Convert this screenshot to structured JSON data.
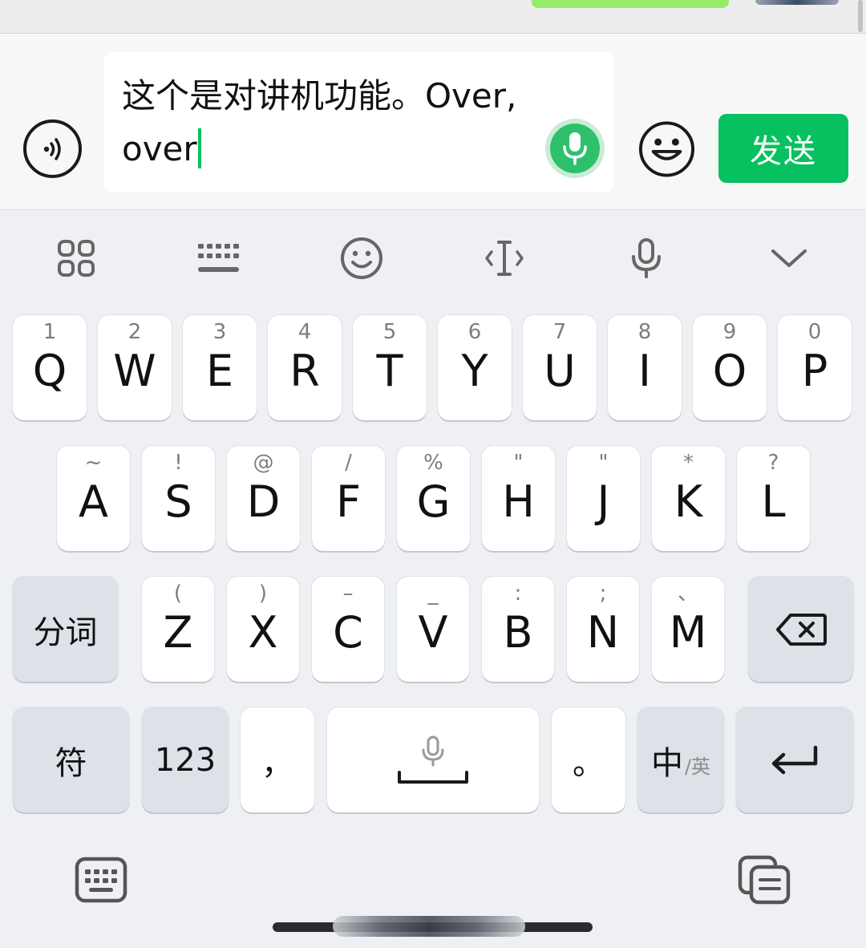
{
  "input": {
    "line1": "这个是对讲机功能。Over,",
    "line2": "over"
  },
  "send_label": "发送",
  "toolbar": {
    "icons": [
      "apps-grid-icon",
      "keyboard-icon",
      "emoji-icon",
      "cursor-icon",
      "microphone-icon",
      "chevron-down-icon"
    ]
  },
  "keyboard": {
    "row1": [
      {
        "hint": "1",
        "key": "Q"
      },
      {
        "hint": "2",
        "key": "W"
      },
      {
        "hint": "3",
        "key": "E"
      },
      {
        "hint": "4",
        "key": "R"
      },
      {
        "hint": "5",
        "key": "T"
      },
      {
        "hint": "6",
        "key": "Y"
      },
      {
        "hint": "7",
        "key": "U"
      },
      {
        "hint": "8",
        "key": "I"
      },
      {
        "hint": "9",
        "key": "O"
      },
      {
        "hint": "0",
        "key": "P"
      }
    ],
    "row2": [
      {
        "hint": "~",
        "key": "A"
      },
      {
        "hint": "!",
        "key": "S"
      },
      {
        "hint": "@",
        "key": "D"
      },
      {
        "hint": "/",
        "key": "F"
      },
      {
        "hint": "%",
        "key": "G"
      },
      {
        "hint": "\"",
        "key": "H"
      },
      {
        "hint": "\"",
        "key": "J"
      },
      {
        "hint": "*",
        "key": "K"
      },
      {
        "hint": "?",
        "key": "L"
      }
    ],
    "row3": [
      {
        "hint": "(",
        "key": "Z"
      },
      {
        "hint": ")",
        "key": "X"
      },
      {
        "hint": "–",
        "key": "C"
      },
      {
        "hint": "_",
        "key": "V"
      },
      {
        "hint": ":",
        "key": "B"
      },
      {
        "hint": ";",
        "key": "N"
      },
      {
        "hint": "、",
        "key": "M"
      }
    ],
    "segment_label": "分词",
    "symbols_label": "符",
    "numbers_label": "123",
    "comma_label": "，",
    "period_label": "。",
    "lang_main": "中",
    "lang_sub": "/英"
  },
  "colors": {
    "accent": "#07c160",
    "keyboard_bg": "#eef0f3",
    "key_bg": "#ffffff",
    "function_key_bg": "#dde1e8"
  }
}
